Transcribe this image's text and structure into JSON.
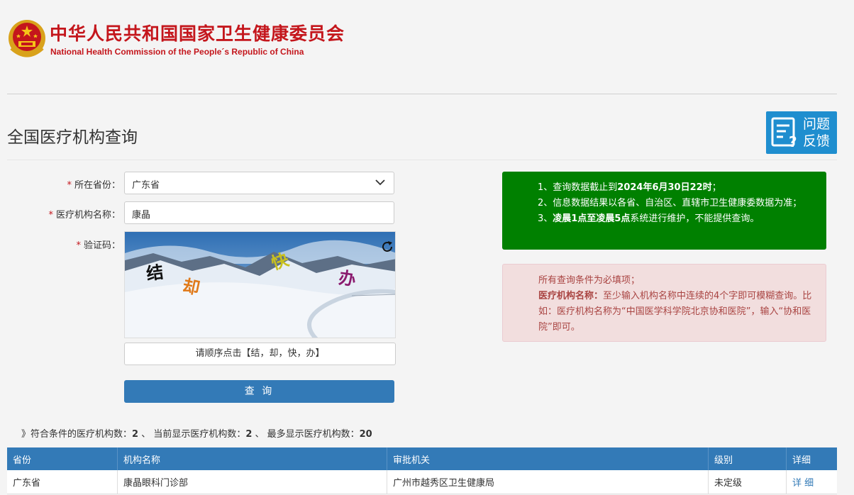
{
  "header": {
    "cn_title": "中华人民共和国国家卫生健康委员会",
    "en_title": "National Health Commission of the People´s Republic of China",
    "brand_color": "#c4161c"
  },
  "page": {
    "title": "全国医疗机构查询"
  },
  "feedback": {
    "line1": "问题",
    "line2": "反馈"
  },
  "form": {
    "province_label": "所在省份：",
    "province_value": "广东省",
    "name_label": "医疗机构名称：",
    "name_value": "康晶",
    "captcha_label": "验证码：",
    "required_mark": "*",
    "captcha_chars": [
      "结",
      "却",
      "快",
      "办"
    ],
    "captcha_instruction": "请顺序点击【结，却，快，办】",
    "submit_label": "查 询"
  },
  "notice_green": {
    "line1_prefix": "1、查询数据截止到",
    "line1_bold": "2024年6月30日22时",
    "line1_suffix": "；",
    "line2": "2、信息数据结果以各省、自治区、直辖市卫生健康委数据为准；",
    "line3_prefix": "3、",
    "line3_bold": "凌晨1点至凌晨5点",
    "line3_suffix": "系统进行维护，不能提供查询。"
  },
  "notice_red": {
    "line1": "所有查询条件为必填项；",
    "bold": "医疗机构名称：",
    "text": "至少输入机构名称中连续的4个字即可模糊查询。比如：医疗机构名称为“中国医学科学院北京协和医院”，输入“协和医院”即可。"
  },
  "summary": {
    "prefix": "》符合条件的医疗机构数：",
    "matched": "2",
    "sep1": " 、 当前显示医疗机构数：",
    "shown": "2",
    "sep2": " 、 最多显示医疗机构数：",
    "max": "20"
  },
  "table": {
    "headers": [
      "省份",
      "机构名称",
      "审批机关",
      "级别",
      "详细"
    ],
    "rows": [
      [
        "广东省",
        "康晶眼科门诊部",
        "广州市越秀区卫生健康局",
        "未定级",
        "详 细"
      ]
    ]
  }
}
